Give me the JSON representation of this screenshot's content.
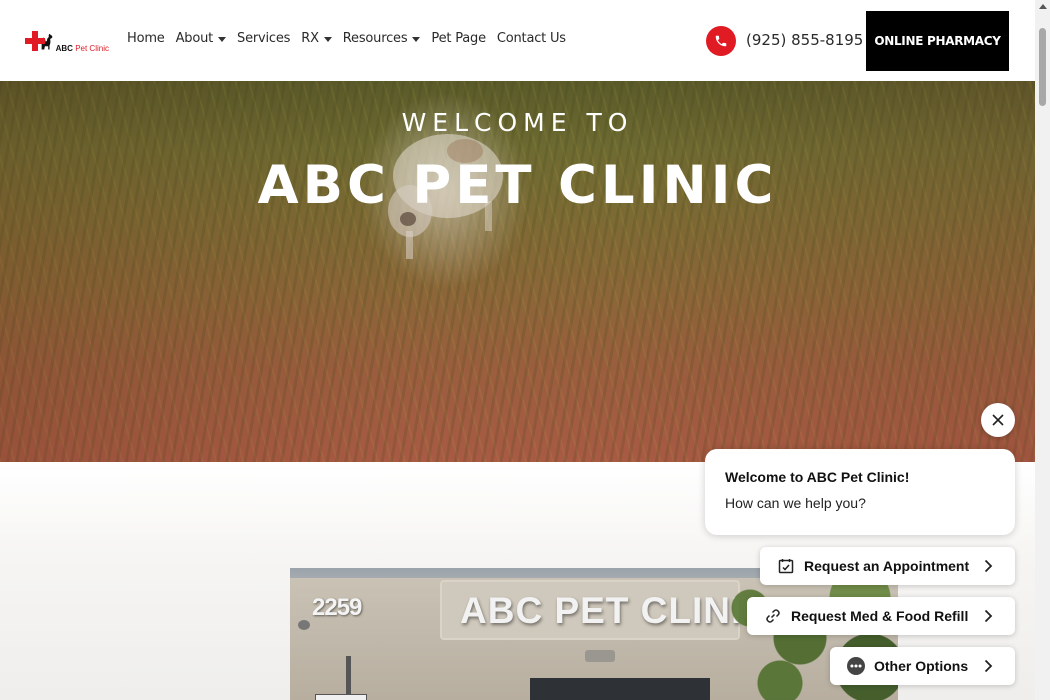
{
  "header": {
    "logo": {
      "text_a": "ABC",
      "text_b": "Pet Clinic"
    },
    "nav": [
      {
        "label": "Home",
        "dropdown": false
      },
      {
        "label": "About",
        "dropdown": true
      },
      {
        "label": "Services",
        "dropdown": false
      },
      {
        "label": "RX",
        "dropdown": true
      },
      {
        "label": "Resources",
        "dropdown": true
      },
      {
        "label": "Pet Page",
        "dropdown": false
      },
      {
        "label": "Contact Us",
        "dropdown": false
      }
    ],
    "phone": "(925) 855-8195",
    "pharmacy_button": "ONLINE PHARMACY"
  },
  "hero": {
    "welcome": "WELCOME TO",
    "title": "ABC PET CLINIC"
  },
  "photo": {
    "building_number": "2259",
    "building_sign": "ABC PET CLINIC"
  },
  "chat": {
    "title": "Welcome to ABC Pet Clinic!",
    "subtitle": "How can we help you?",
    "buttons": {
      "appointment": "Request an Appointment",
      "refill": "Request Med & Food Refill",
      "other": "Other Options"
    }
  },
  "colors": {
    "brand_red": "#e01b24",
    "pharmacy_bg": "#000000"
  },
  "icons": {
    "phone": "phone-icon",
    "close": "close-icon",
    "appointment": "calendar-check-icon",
    "refill": "link-icon",
    "other": "chat-dots-icon",
    "chevron": "chevron-right-icon"
  }
}
